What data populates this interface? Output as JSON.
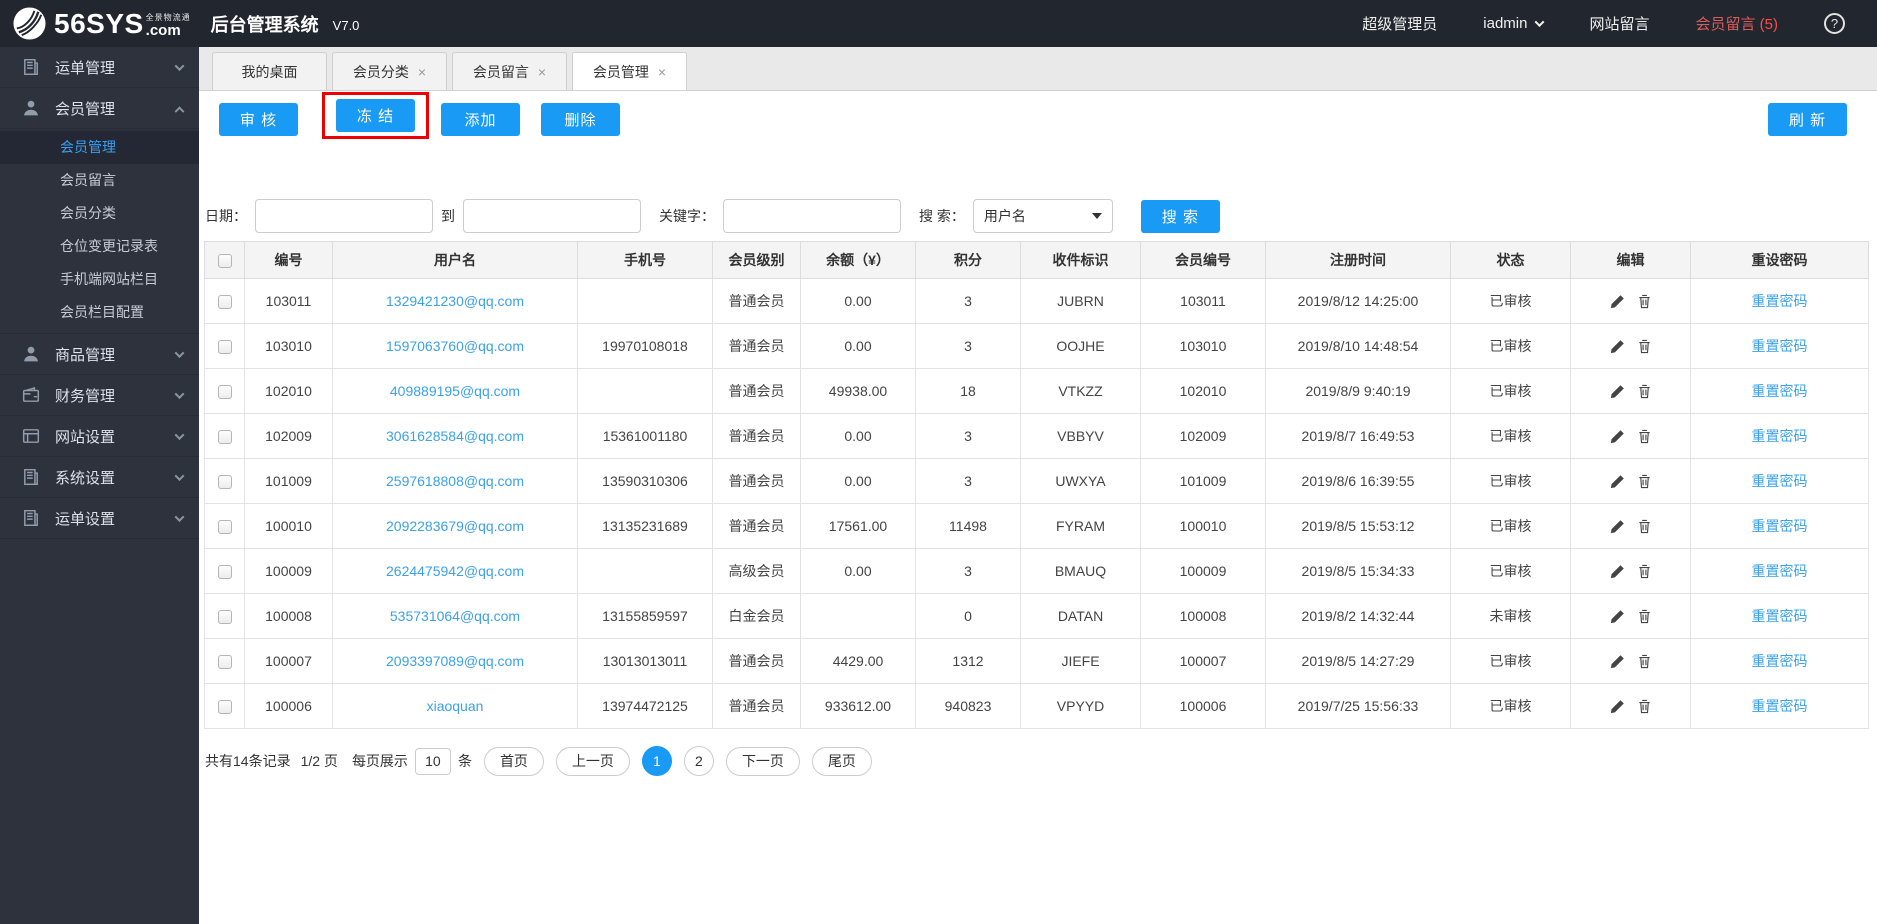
{
  "colors": {
    "accent_blue": "#189af5",
    "link_blue": "#3ba1e8",
    "annotation_red": "#ec0000",
    "notice_red": "#ff4a4a"
  },
  "topbar": {
    "brand_main": "56SYS",
    "brand_tagline": "全景物流通",
    "brand_com": ".com",
    "app_title": "后台管理系统",
    "version": "V7.0",
    "role": "超级管理员",
    "username": "iadmin",
    "site_messages": "网站留言",
    "member_messages": "会员留言",
    "member_messages_count": "(5)",
    "help": "?"
  },
  "sidebar": {
    "items": [
      {
        "label": "运单管理",
        "icon": "document"
      },
      {
        "label": "会员管理",
        "icon": "user",
        "children": [
          {
            "label": "会员管理",
            "active": true
          },
          {
            "label": "会员留言"
          },
          {
            "label": "会员分类"
          },
          {
            "label": "仓位变更记录表"
          },
          {
            "label": "手机端网站栏目"
          },
          {
            "label": "会员栏目配置"
          }
        ]
      },
      {
        "label": "商品管理",
        "icon": "user"
      },
      {
        "label": "财务管理",
        "icon": "wallet"
      },
      {
        "label": "网站设置",
        "icon": "browser"
      },
      {
        "label": "系统设置",
        "icon": "document"
      },
      {
        "label": "运单设置",
        "icon": "document"
      }
    ]
  },
  "tabs": [
    {
      "label": "我的桌面",
      "closable": false
    },
    {
      "label": "会员分类",
      "closable": true
    },
    {
      "label": "会员留言",
      "closable": true
    },
    {
      "label": "会员管理",
      "closable": true,
      "active": true
    }
  ],
  "tab_close": "×",
  "toolbar": {
    "audit": "审 核",
    "freeze": "冻 结",
    "add": "添加",
    "delete": "删除",
    "refresh": "刷 新"
  },
  "filters": {
    "date_label": "日期：",
    "to_label": "到",
    "keyword_label": "关键字：",
    "search_label": "搜 索：",
    "search_type": "用户名",
    "search_button": "搜 索"
  },
  "table": {
    "headers": [
      "编号",
      "用户名",
      "手机号",
      "会员级别",
      "余额（¥）",
      "积分",
      "收件标识",
      "会员编号",
      "注册时间",
      "状态",
      "编辑",
      "重设密码"
    ],
    "rows": [
      {
        "id": "103011",
        "username": "1329421230@qq.com",
        "phone": "",
        "level": "普通会员",
        "balance": "0.00",
        "points": "3",
        "code": "JUBRN",
        "member_no": "103011",
        "registered": "2019/8/12 14:25:00",
        "status": "已审核"
      },
      {
        "id": "103010",
        "username": "1597063760@qq.com",
        "phone": "19970108018",
        "level": "普通会员",
        "balance": "0.00",
        "points": "3",
        "code": "OOJHE",
        "member_no": "103010",
        "registered": "2019/8/10 14:48:54",
        "status": "已审核"
      },
      {
        "id": "102010",
        "username": "409889195@qq.com",
        "phone": "",
        "level": "普通会员",
        "balance": "49938.00",
        "points": "18",
        "code": "VTKZZ",
        "member_no": "102010",
        "registered": "2019/8/9 9:40:19",
        "status": "已审核"
      },
      {
        "id": "102009",
        "username": "3061628584@qq.com",
        "phone": "15361001180",
        "level": "普通会员",
        "balance": "0.00",
        "points": "3",
        "code": "VBBYV",
        "member_no": "102009",
        "registered": "2019/8/7 16:49:53",
        "status": "已审核"
      },
      {
        "id": "101009",
        "username": "2597618808@qq.com",
        "phone": "13590310306",
        "level": "普通会员",
        "balance": "0.00",
        "points": "3",
        "code": "UWXYA",
        "member_no": "101009",
        "registered": "2019/8/6 16:39:55",
        "status": "已审核"
      },
      {
        "id": "100010",
        "username": "2092283679@qq.com",
        "phone": "13135231689",
        "level": "普通会员",
        "balance": "17561.00",
        "points": "11498",
        "code": "FYRAM",
        "member_no": "100010",
        "registered": "2019/8/5 15:53:12",
        "status": "已审核"
      },
      {
        "id": "100009",
        "username": "2624475942@qq.com",
        "phone": "",
        "level": "高级会员",
        "balance": "0.00",
        "points": "3",
        "code": "BMAUQ",
        "member_no": "100009",
        "registered": "2019/8/5 15:34:33",
        "status": "已审核"
      },
      {
        "id": "100008",
        "username": "535731064@qq.com",
        "phone": "13155859597",
        "level": "白金会员",
        "balance": "",
        "points": "0",
        "code": "DATAN",
        "member_no": "100008",
        "registered": "2019/8/2 14:32:44",
        "status": "未审核"
      },
      {
        "id": "100007",
        "username": "2093397089@qq.com",
        "phone": "13013013011",
        "level": "普通会员",
        "balance": "4429.00",
        "points": "1312",
        "code": "JIEFE",
        "member_no": "100007",
        "registered": "2019/8/5 14:27:29",
        "status": "已审核"
      },
      {
        "id": "100006",
        "username": "xiaoquan",
        "phone": "13974472125",
        "level": "普通会员",
        "balance": "933612.00",
        "points": "940823",
        "code": "VPYYD",
        "member_no": "100006",
        "registered": "2019/7/25 15:56:33",
        "status": "已审核"
      }
    ]
  },
  "labels": {
    "reset_password": "重置密码"
  },
  "pagination": {
    "total": "共有14条记录",
    "page_info": "1/2 页",
    "per_page_label": "每页展示",
    "per_page": "10",
    "unit": "条",
    "first": "首页",
    "prev": "上一页",
    "pages": [
      "1",
      "2"
    ],
    "next": "下一页",
    "last": "尾页"
  }
}
